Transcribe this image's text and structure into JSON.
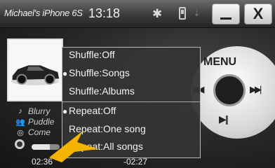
{
  "topbar": {
    "device_name": "Michael's iPhone 6S",
    "time": "13:18",
    "bluetooth_icon": "bluetooth-icon",
    "phone_icon": "phone-icon",
    "usb_icon": "usb-icon",
    "close_label": "X"
  },
  "track": {
    "song": "Blurry",
    "artist": "Puddle",
    "album": "Come",
    "elapsed": "02:36",
    "remaining": "-02:27",
    "progress_fraction": 0.65
  },
  "wheel": {
    "menu_label": "MENU",
    "next_glyph": "▶▶|",
    "prev_glyph": "|◀◀",
    "playpause_glyph": "▶||"
  },
  "popup": {
    "items": [
      {
        "label": "Shuffle:Off",
        "selected": false
      },
      {
        "label": "Shuffle:Songs",
        "selected": true
      },
      {
        "label": "Shuffle:Albums",
        "selected": false
      },
      {
        "label": "Repeat:Off",
        "selected": true
      },
      {
        "label": "Repeat:One song",
        "selected": false
      },
      {
        "label": "Repeat:All songs",
        "selected": false
      }
    ]
  },
  "colors": {
    "accent_arrow": "#f5b400",
    "popup_bg": "#343434",
    "wheel": "#e0e0e0"
  }
}
